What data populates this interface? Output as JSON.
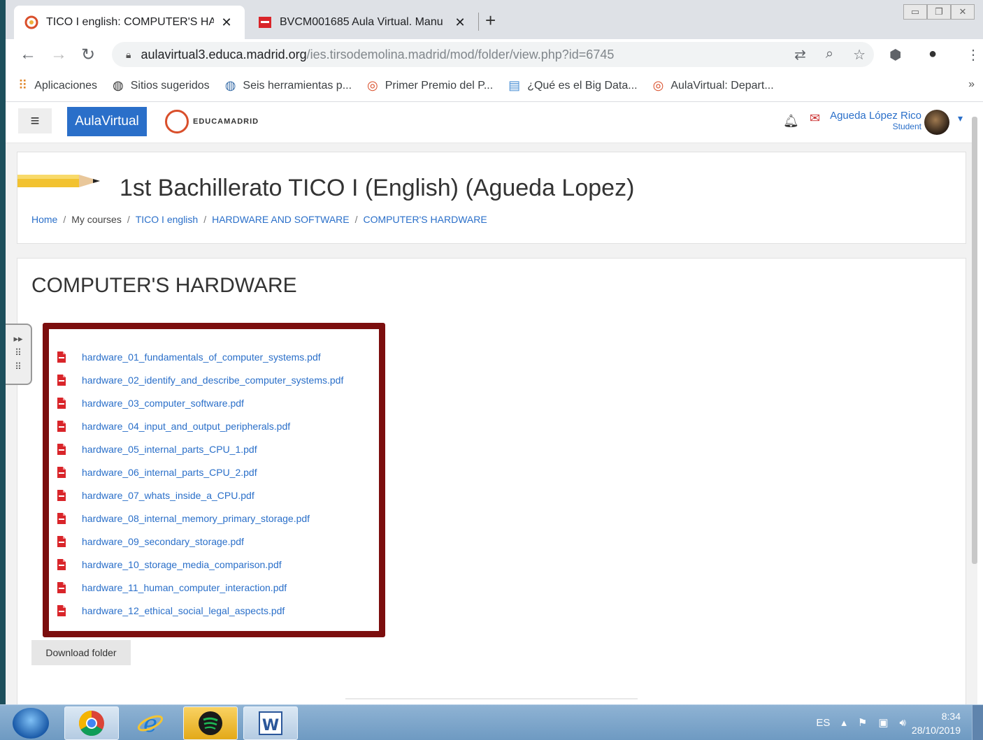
{
  "browser": {
    "tabs": [
      {
        "title": "TICO I english: COMPUTER'S HA",
        "close": "✕"
      },
      {
        "title": "BVCM001685 Aula Virtual. Manu",
        "close": "✕"
      }
    ],
    "new_tab": "+",
    "url_host": "aulavirtual3.educa.madrid.org",
    "url_path": "/ies.tirsodemolina.madrid/mod/folder/view.php?id=6745",
    "bookmarks": [
      "Aplicaciones",
      "Sitios sugeridos",
      "Seis herramientas p...",
      "Primer Premio del P...",
      "¿Qué es el Big Data...",
      "AulaVirtual: Depart..."
    ],
    "bookmarks_more": "»"
  },
  "site": {
    "brand": "AulaVirtual",
    "logo_text": "EDUCAMADRID",
    "user_name": "Agueda López Rico",
    "user_role": "Student"
  },
  "course": {
    "title": "1st Bachillerato TICO I (English) (Agueda Lopez)",
    "breadcrumbs": [
      "Home",
      "My courses",
      "TICO I english",
      "HARDWARE AND SOFTWARE",
      "COMPUTER'S HARDWARE"
    ],
    "sep": "/"
  },
  "folder": {
    "title": "COMPUTER'S HARDWARE",
    "files": [
      "hardware_01_fundamentals_of_computer_systems.pdf",
      "hardware_02_identify_and_describe_computer_systems.pdf",
      "hardware_03_computer_software.pdf",
      "hardware_04_input_and_output_peripherals.pdf",
      "hardware_05_internal_parts_CPU_1.pdf",
      "hardware_06_internal_parts_CPU_2.pdf",
      "hardware_07_whats_inside_a_CPU.pdf",
      "hardware_08_internal_memory_primary_storage.pdf",
      "hardware_09_secondary_storage.pdf",
      "hardware_10_storage_media_comparison.pdf",
      "hardware_11_human_computer_interaction.pdf",
      "hardware_12_ethical_social_legal_aspects.pdf"
    ],
    "download_label": "Download folder"
  },
  "taskbar": {
    "lang": "ES",
    "time": "8:34",
    "date": "28/10/2019"
  },
  "colors": {
    "link": "#2a6fc9",
    "highlight_border": "#7c0e0e"
  }
}
